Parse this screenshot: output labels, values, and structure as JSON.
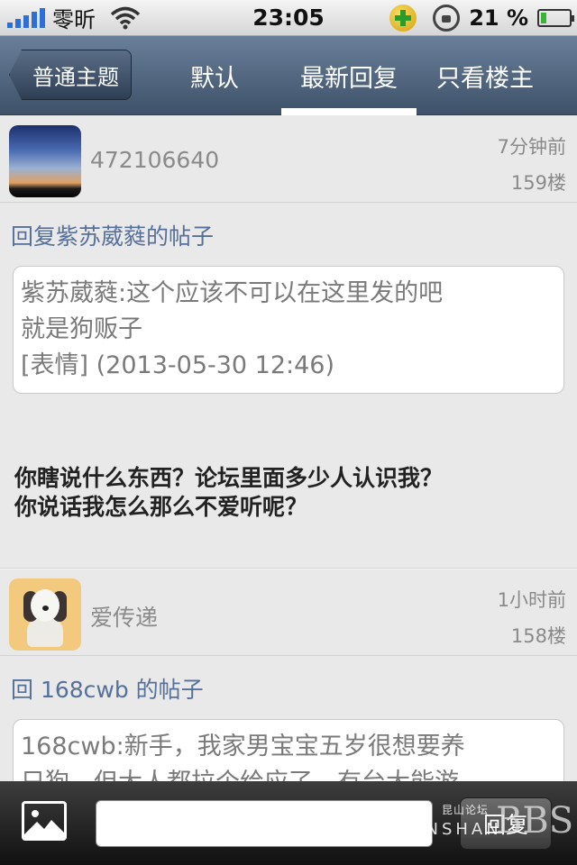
{
  "status_bar": {
    "carrier": "零昕",
    "time": "23:05",
    "battery_percent": "21 %",
    "battery_level": 0.21,
    "icons": [
      "signal-icon",
      "wifi-icon",
      "360-security-icon",
      "rotation-lock-icon",
      "battery-icon"
    ]
  },
  "nav": {
    "back_label": "普通主题",
    "tabs": [
      {
        "label": "默认"
      },
      {
        "label": "最新回复",
        "selected": true
      },
      {
        "label": "只看楼主"
      }
    ]
  },
  "posts": [
    {
      "username": "472106640",
      "time": "7分钟前",
      "floor": "159楼",
      "reply_title": "回复紫苏葳蕤的帖子",
      "quote_lines": [
        "紫苏葳蕤:这个应该不可以在这里发的吧",
        "就是狗贩子",
        "[表情] (2013-05-30 12:46)"
      ],
      "body_lines": [
        "你瞎说什么东西？论坛里面多少人认识我？",
        "你说话我怎么那么不爱听呢？"
      ]
    },
    {
      "username": "爱传递",
      "time": "1小时前",
      "floor": "158楼",
      "reply_title": "回 168cwb 的帖子",
      "quote_lines": [
        "168cwb:新手，我家男宝宝五岁很想要养",
        "只狗，但大人都拉个给应了，有台大能游"
      ]
    }
  ],
  "bottom_bar": {
    "reply_button": "回复",
    "reply_placeholder": ""
  },
  "watermark": {
    "brand_small": "昆山论坛",
    "city": "KUNSHAN",
    "bbs": "BBS"
  },
  "colors": {
    "nav_bar": "#4e6280",
    "link_blue": "#55709a",
    "bottom_bar": "#222222"
  }
}
